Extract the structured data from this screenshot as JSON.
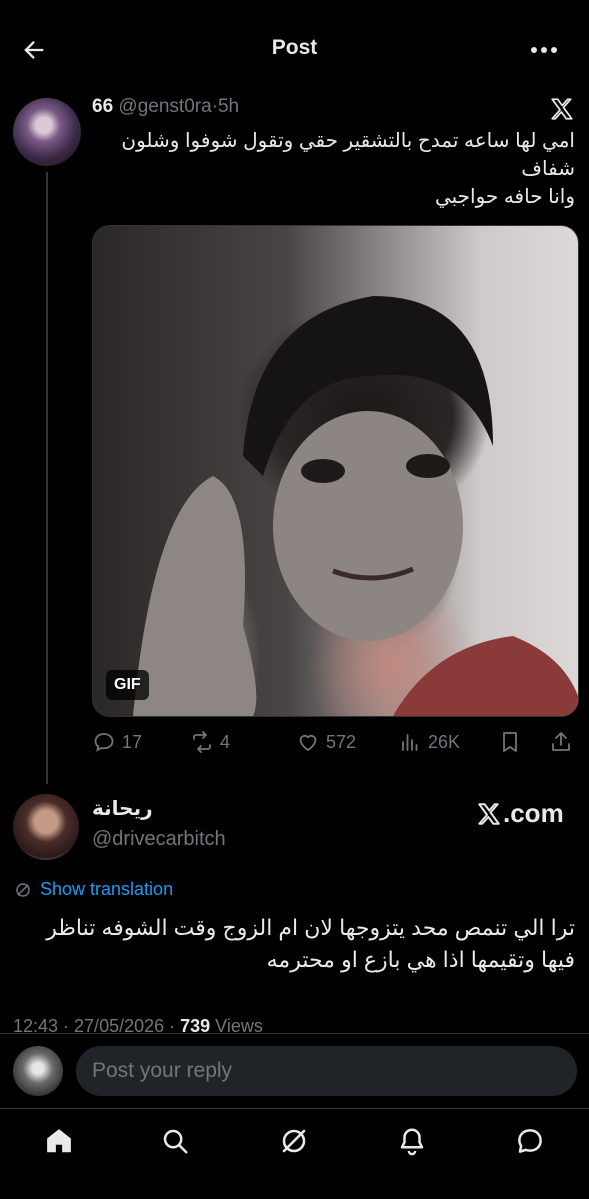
{
  "header": {
    "title": "Post"
  },
  "parent_tweet": {
    "name": "66",
    "handle": "@genst0ra",
    "separator": "·",
    "time": "5h",
    "text_lines": [
      "امي لها ساعه تمدح بالتشقير حقي وتقول شوفوا وشلون",
      "شفاف",
      "وانا حافه حواجبي"
    ],
    "media_badge": "GIF",
    "stats": {
      "replies": "17",
      "reposts": "4",
      "likes": "572",
      "views": "26K"
    }
  },
  "main_tweet": {
    "name": "ريحانة",
    "handle": "@drivecarbitch",
    "watermark": ".com",
    "translate_label": "Show translation",
    "text": "ترا الي تنمص محد يتزوجها لان ام الزوج وقت الشوفه تناظر فيها وتقيمها اذا هي بازع او محترمه",
    "meta_time": "12:43 · 27/05/2026 · ",
    "meta_views_count": "739",
    "meta_views_label": " Views"
  },
  "reply": {
    "placeholder": "Post your reply"
  },
  "colors": {
    "background": "#000000",
    "accent": "#1d9bf0",
    "muted": "#71767b",
    "text": "#e7e9ea"
  },
  "icons": [
    "back-arrow-icon",
    "more-icon",
    "x-logo-icon",
    "reply-icon",
    "repost-icon",
    "like-icon",
    "views-icon",
    "bookmark-icon",
    "share-icon",
    "translate-icon",
    "home-icon",
    "search-icon",
    "grok-icon",
    "bell-icon",
    "messages-icon"
  ]
}
